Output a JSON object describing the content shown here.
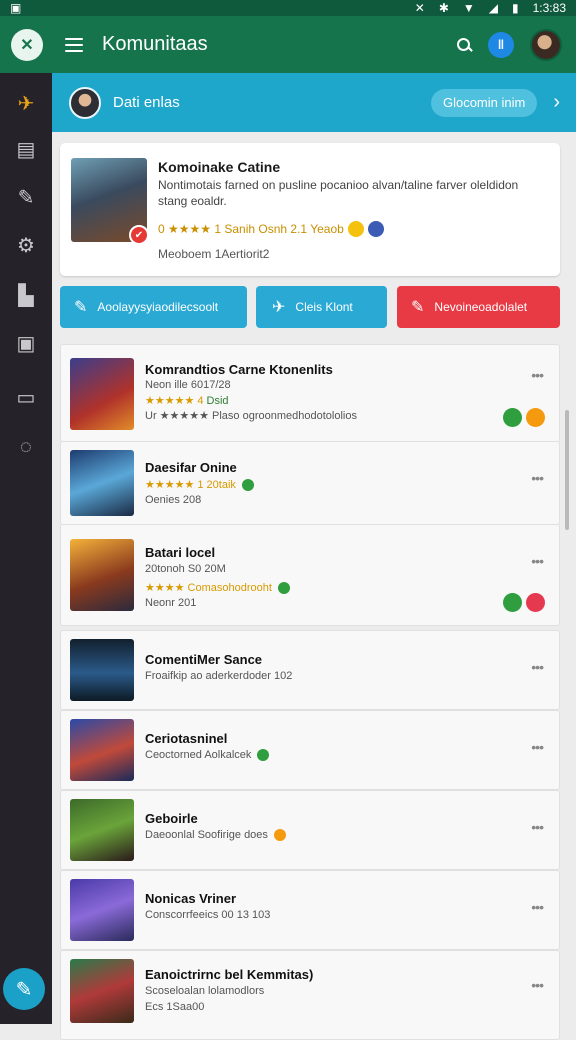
{
  "status": {
    "time": "1:3:83"
  },
  "appbar": {
    "title": "Komunitaas"
  },
  "profile": {
    "name": "Dati enlas",
    "button": "Glocomin inim"
  },
  "featured": {
    "title": "Komoinake Catine",
    "description": "Nontimotais farned on pusline pocanioo alvan/taline farver oleldidon stang eoaldr.",
    "rating": "0 ★★★★ 1 Sanih Osnh 2.1 Yeaob",
    "meta": "Meoboem 1Aertiorit2"
  },
  "actions": [
    {
      "label": "Aoolayysyiaodilecsoolt",
      "color": "#29a9d4",
      "icon": "pencil-icon"
    },
    {
      "label": "Cleis Klont",
      "color": "#29a9d4",
      "icon": "pin-icon"
    },
    {
      "label": "Nevoineoadolalet",
      "color": "#e83a44",
      "icon": "hammer-icon"
    }
  ],
  "games": [
    {
      "title": "Komrandtios Carne Ktonenlits",
      "line1": "Neon ille 6017/28",
      "stars": "★★★★★ 4",
      "tag": "Dsid",
      "line2": "Ur ★★★★★ Plaso ogroonmedhodotololios"
    },
    {
      "title": "Daesifar Onine",
      "stars": "★★★★★ 1 20taik",
      "line1": "Oenies 208"
    },
    {
      "title": "Batari locel",
      "line1": "20tonoh S0 20M",
      "stars": "★★★★ Comasohodrooht",
      "line2": "Neonr 201"
    },
    {
      "title": "ComentiMer Sance",
      "line1": "Froaifkip ao aderkerdoder 102"
    },
    {
      "title": "Ceriotasninel",
      "line1": "Ceoctorned Aolkalcek"
    },
    {
      "title": "Geboirle",
      "line1": "Daeoonlal Soofirige does"
    },
    {
      "title": "Nonicas Vriner",
      "line1": "Conscorrfeeics 00 13 103"
    },
    {
      "title": "Eanoictrirnc bel Kemmitas)",
      "line1": "Scoseloalan lolamodlors",
      "line2": "Ecs 1Saa00"
    }
  ],
  "colors": {
    "primary": "#16744c",
    "accent": "#1fa6cb",
    "danger": "#e83a44"
  }
}
